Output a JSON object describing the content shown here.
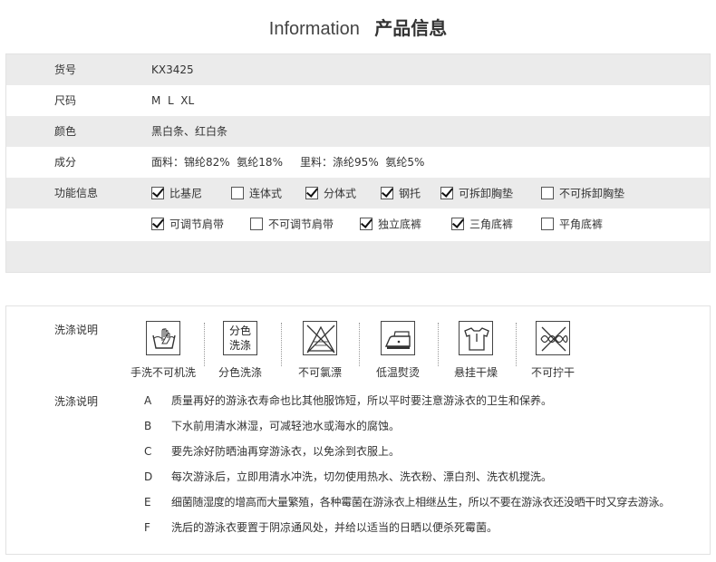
{
  "title": {
    "en": "Information",
    "zh": "产品信息"
  },
  "info": {
    "sku_label": "货号",
    "sku_value": "KX3425",
    "size_label": "尺码",
    "size_value": "M  L  XL",
    "color_label": "颜色",
    "color_value": "黑白条、红白条",
    "material_label": "成分",
    "material_value": "面料：锦纶82%  氨纶18%     里料：涤纶95%  氨纶5%",
    "features_label": "功能信息",
    "features_row1": [
      {
        "label": "比基尼",
        "checked": true
      },
      {
        "label": "连体式",
        "checked": false
      },
      {
        "label": "分体式",
        "checked": true
      },
      {
        "label": "钢托",
        "checked": true
      },
      {
        "label": "可拆卸胸垫",
        "checked": true
      },
      {
        "label": "不可拆卸胸垫",
        "checked": false
      }
    ],
    "features_row2": [
      {
        "label": "可调节肩带",
        "checked": true
      },
      {
        "label": "不可调节肩带",
        "checked": false
      },
      {
        "label": "独立底裤",
        "checked": true
      },
      {
        "label": "三角底裤",
        "checked": true
      },
      {
        "label": "平角底裤",
        "checked": false
      }
    ]
  },
  "care": {
    "label": "洗涤说明",
    "icons": [
      {
        "icon": "hand-wash-icon",
        "caption": "手洗不可机洗"
      },
      {
        "icon": "separate-wash-icon",
        "caption": "分色洗涤",
        "icon_text_1": "分色",
        "icon_text_2": "洗涤"
      },
      {
        "icon": "no-bleach-icon",
        "caption": "不可氯漂"
      },
      {
        "icon": "low-iron-icon",
        "caption": "低温熨烫"
      },
      {
        "icon": "hang-dry-icon",
        "caption": "悬挂干燥"
      },
      {
        "icon": "no-wring-icon",
        "caption": "不可拧干"
      }
    ],
    "notes_label": "洗涤说明",
    "notes": [
      {
        "letter": "A",
        "text": "质量再好的游泳衣寿命也比其他服饰短，所以平时要注意游泳衣的卫生和保养。"
      },
      {
        "letter": "B",
        "text": "下水前用清水淋湿，可减轻池水或海水的腐蚀。"
      },
      {
        "letter": "C",
        "text": "要先涂好防晒油再穿游泳衣，以免涂到衣服上。"
      },
      {
        "letter": "D",
        "text": "每次游泳后，立即用清水冲洗，切勿使用热水、洗衣粉、漂白剂、洗衣机搅洗。"
      },
      {
        "letter": "E",
        "text": "细菌随湿度的增高而大量繁殖，各种霉菌在游泳衣上相继丛生，所以不要在游泳衣还没晒干时又穿去游泳。"
      },
      {
        "letter": "F",
        "text": "洗后的游泳衣要置于阴凉通风处，并给以适当的日晒以便杀死霉菌。"
      }
    ]
  }
}
